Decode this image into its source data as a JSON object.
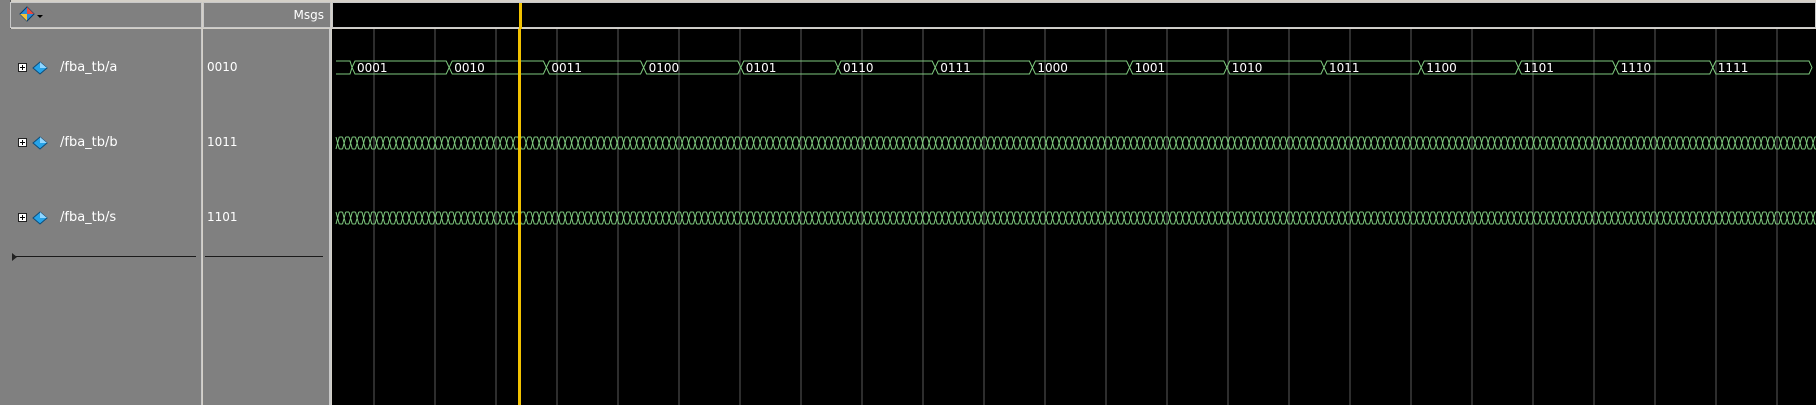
{
  "header": {
    "msgs_label": "Msgs",
    "toolbar_icon": "wave-window-icon"
  },
  "signals": [
    {
      "name": "/fba_tb/a",
      "value": "0010",
      "expand_icon": "expand-plus-icon",
      "type_icon": "diamond-signal-icon"
    },
    {
      "name": "/fba_tb/b",
      "value": "1011",
      "expand_icon": "expand-plus-icon",
      "type_icon": "diamond-signal-icon"
    },
    {
      "name": "/fba_tb/s",
      "value": "1101",
      "expand_icon": "expand-plus-icon",
      "type_icon": "diamond-signal-icon"
    }
  ],
  "waveform": {
    "bus_a_values": [
      "0001",
      "0010",
      "0011",
      "0100",
      "0101",
      "0110",
      "0111",
      "1000",
      "1001",
      "1010",
      "1011",
      "1100",
      "1101",
      "1110",
      "1111"
    ],
    "colors": {
      "wave": "#7ec87e",
      "cursor": "#f2c200",
      "grid": "#5a5a5a",
      "background": "#000000",
      "text": "#ffffff"
    }
  }
}
